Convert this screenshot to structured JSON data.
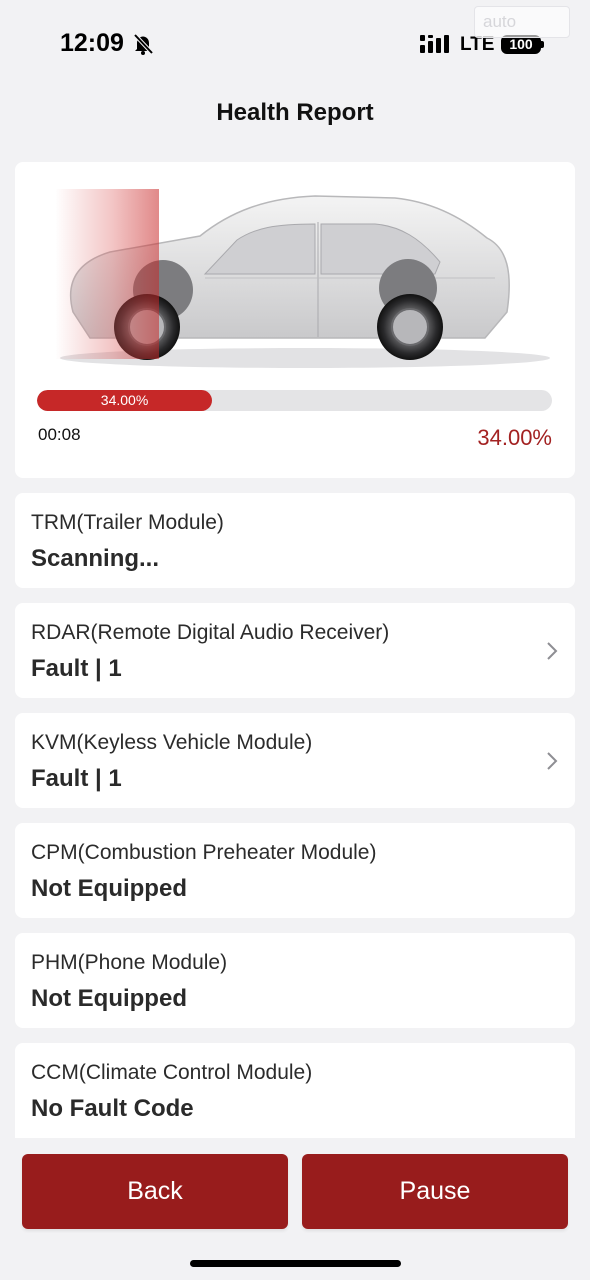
{
  "status_bar": {
    "time": "12:09",
    "network": "LTE",
    "battery": "100",
    "watermark": "auto"
  },
  "header": {
    "title": "Health Report"
  },
  "scan": {
    "progress_fraction": 0.34,
    "progress_label": "34.00%",
    "elapsed": "00:08",
    "percent_text": "34.00%",
    "accent_color": "#c62828"
  },
  "modules": [
    {
      "name": "TRM(Trailer Module)",
      "status": "Scanning...",
      "has_detail": false
    },
    {
      "name": "RDAR(Remote Digital Audio Receiver)",
      "status": "Fault | 1",
      "has_detail": true
    },
    {
      "name": "KVM(Keyless Vehicle Module)",
      "status": "Fault | 1",
      "has_detail": true
    },
    {
      "name": "CPM(Combustion Preheater Module)",
      "status": "Not Equipped",
      "has_detail": false
    },
    {
      "name": "PHM(Phone Module)",
      "status": "Not Equipped",
      "has_detail": false
    },
    {
      "name": "CCM(Climate Control Module)",
      "status": "No Fault Code",
      "has_detail": false
    }
  ],
  "actions": {
    "back_label": "Back",
    "pause_label": "Pause",
    "button_color": "#981c1c"
  },
  "icons": {
    "silent": "bell-off-icon",
    "signal": "signal-icon",
    "detail": "chevron-right-icon"
  }
}
